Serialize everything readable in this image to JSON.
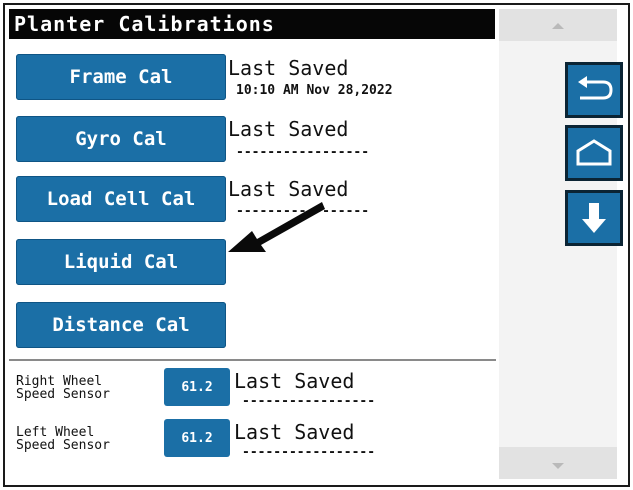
{
  "title": "Planter Calibrations",
  "calibrations": [
    {
      "button_label": "Frame Cal",
      "status_label": "Last Saved",
      "saved_value": "10:10 AM Nov 28,2022"
    },
    {
      "button_label": "Gyro Cal",
      "status_label": "Last Saved",
      "saved_value": "-----------------"
    },
    {
      "button_label": "Load Cell Cal",
      "status_label": "Last Saved",
      "saved_value": "-----------------"
    },
    {
      "button_label": "Liquid Cal"
    },
    {
      "button_label": "Distance Cal"
    }
  ],
  "sensors": [
    {
      "label_line1": "Right Wheel",
      "label_line2": "Speed Sensor",
      "value": "61.2",
      "status_label": "Last Saved",
      "saved_value": "-----------------"
    },
    {
      "label_line1": "Left Wheel",
      "label_line2": "Speed Sensor",
      "value": "61.2",
      "status_label": "Last Saved",
      "saved_value": "-----------------"
    }
  ],
  "side_buttons": {
    "back_icon": "back-arrow-icon",
    "home_icon": "home-icon",
    "down_icon": "down-arrow-icon"
  },
  "colors": {
    "button_blue": "#1b6fa6",
    "title_bg": "#060606"
  }
}
